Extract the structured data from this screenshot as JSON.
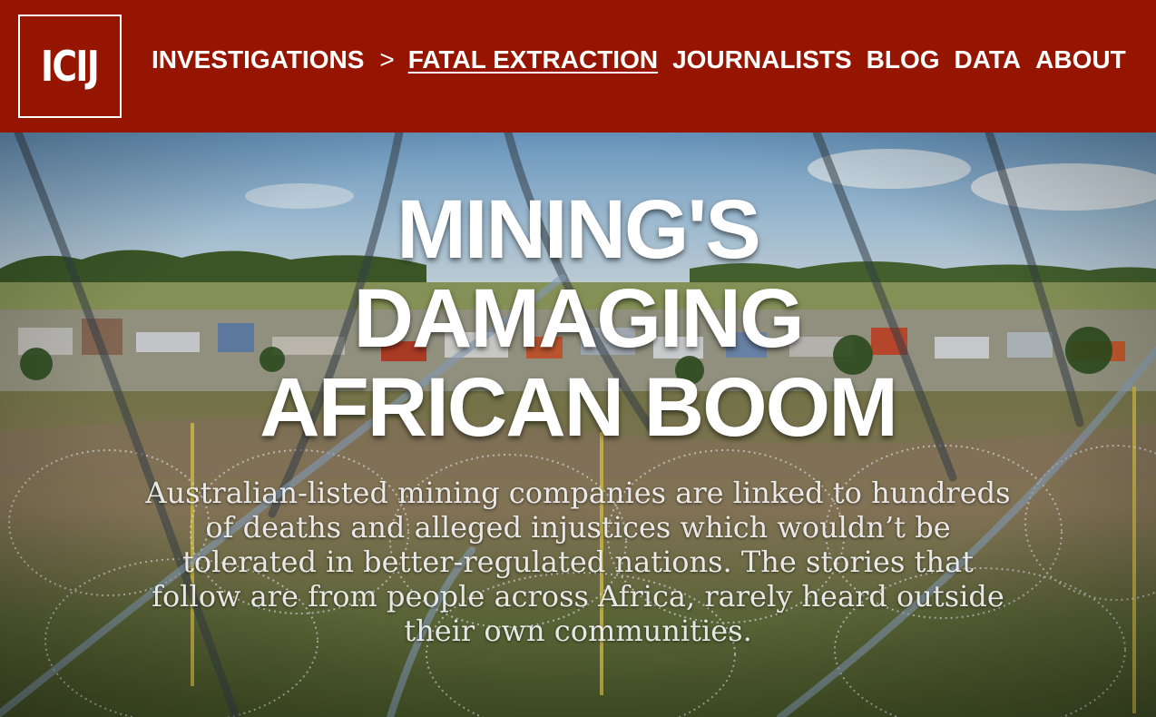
{
  "header": {
    "logo_text": "ICIJ",
    "nav": {
      "investigations": "INVESTIGATIONS",
      "separator": ">",
      "fatal_extraction": "FATAL EXTRACTION",
      "journalists": "JOURNALISTS",
      "blog": "BLOG",
      "data": "DATA",
      "about": "ABOUT"
    }
  },
  "hero": {
    "headline_lines": [
      "MINING'S",
      "DAMAGING",
      "AFRICAN BOOM"
    ],
    "dek": "Australian-listed mining companies are linked to hundreds of deaths and alleged injustices which wouldn’t be tolerated in better-regulated nations. The stories that follow are from people across Africa, rarely heard outside their own communities."
  },
  "colors": {
    "header_bg": "#951500",
    "text": "#ffffff"
  }
}
